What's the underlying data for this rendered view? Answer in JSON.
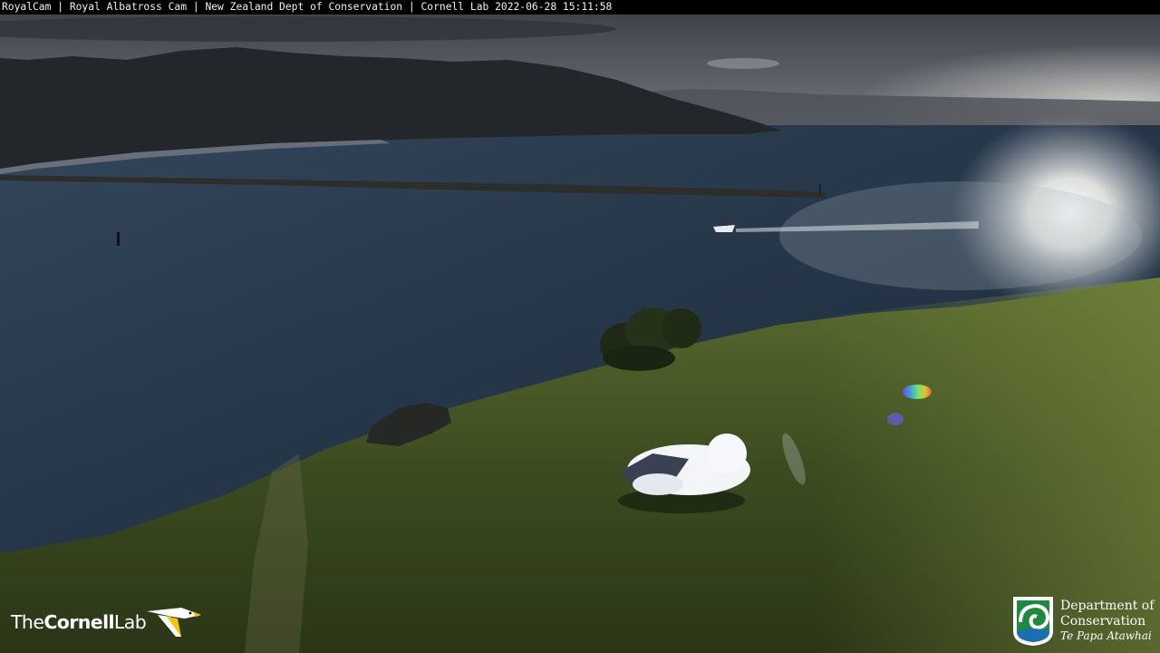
{
  "overlay": {
    "title": "RoyalCam | Royal Albatross Cam | New Zealand Dept of Conservation | Cornell Lab 2022-06-28 15:11:58"
  },
  "logos": {
    "cornell": {
      "word1": "The",
      "word2": "Cornell",
      "word3": "Lab"
    },
    "doc": {
      "line1": "Department of",
      "line2": "Conservation",
      "line3": "Te Papa Atawhai"
    }
  },
  "scene": {
    "subjects": [
      "sky",
      "headland",
      "harbour-water",
      "breakwater",
      "motor-boat",
      "sun-glare",
      "grassy-hillside",
      "bush",
      "rock",
      "albatross-chick"
    ]
  },
  "colors": {
    "sky": "#5a5e66",
    "water": "#2a3a4c",
    "grass": "#4a5e2a",
    "chick": "#f4f6fa",
    "doc_green": "#1f8a3f"
  }
}
